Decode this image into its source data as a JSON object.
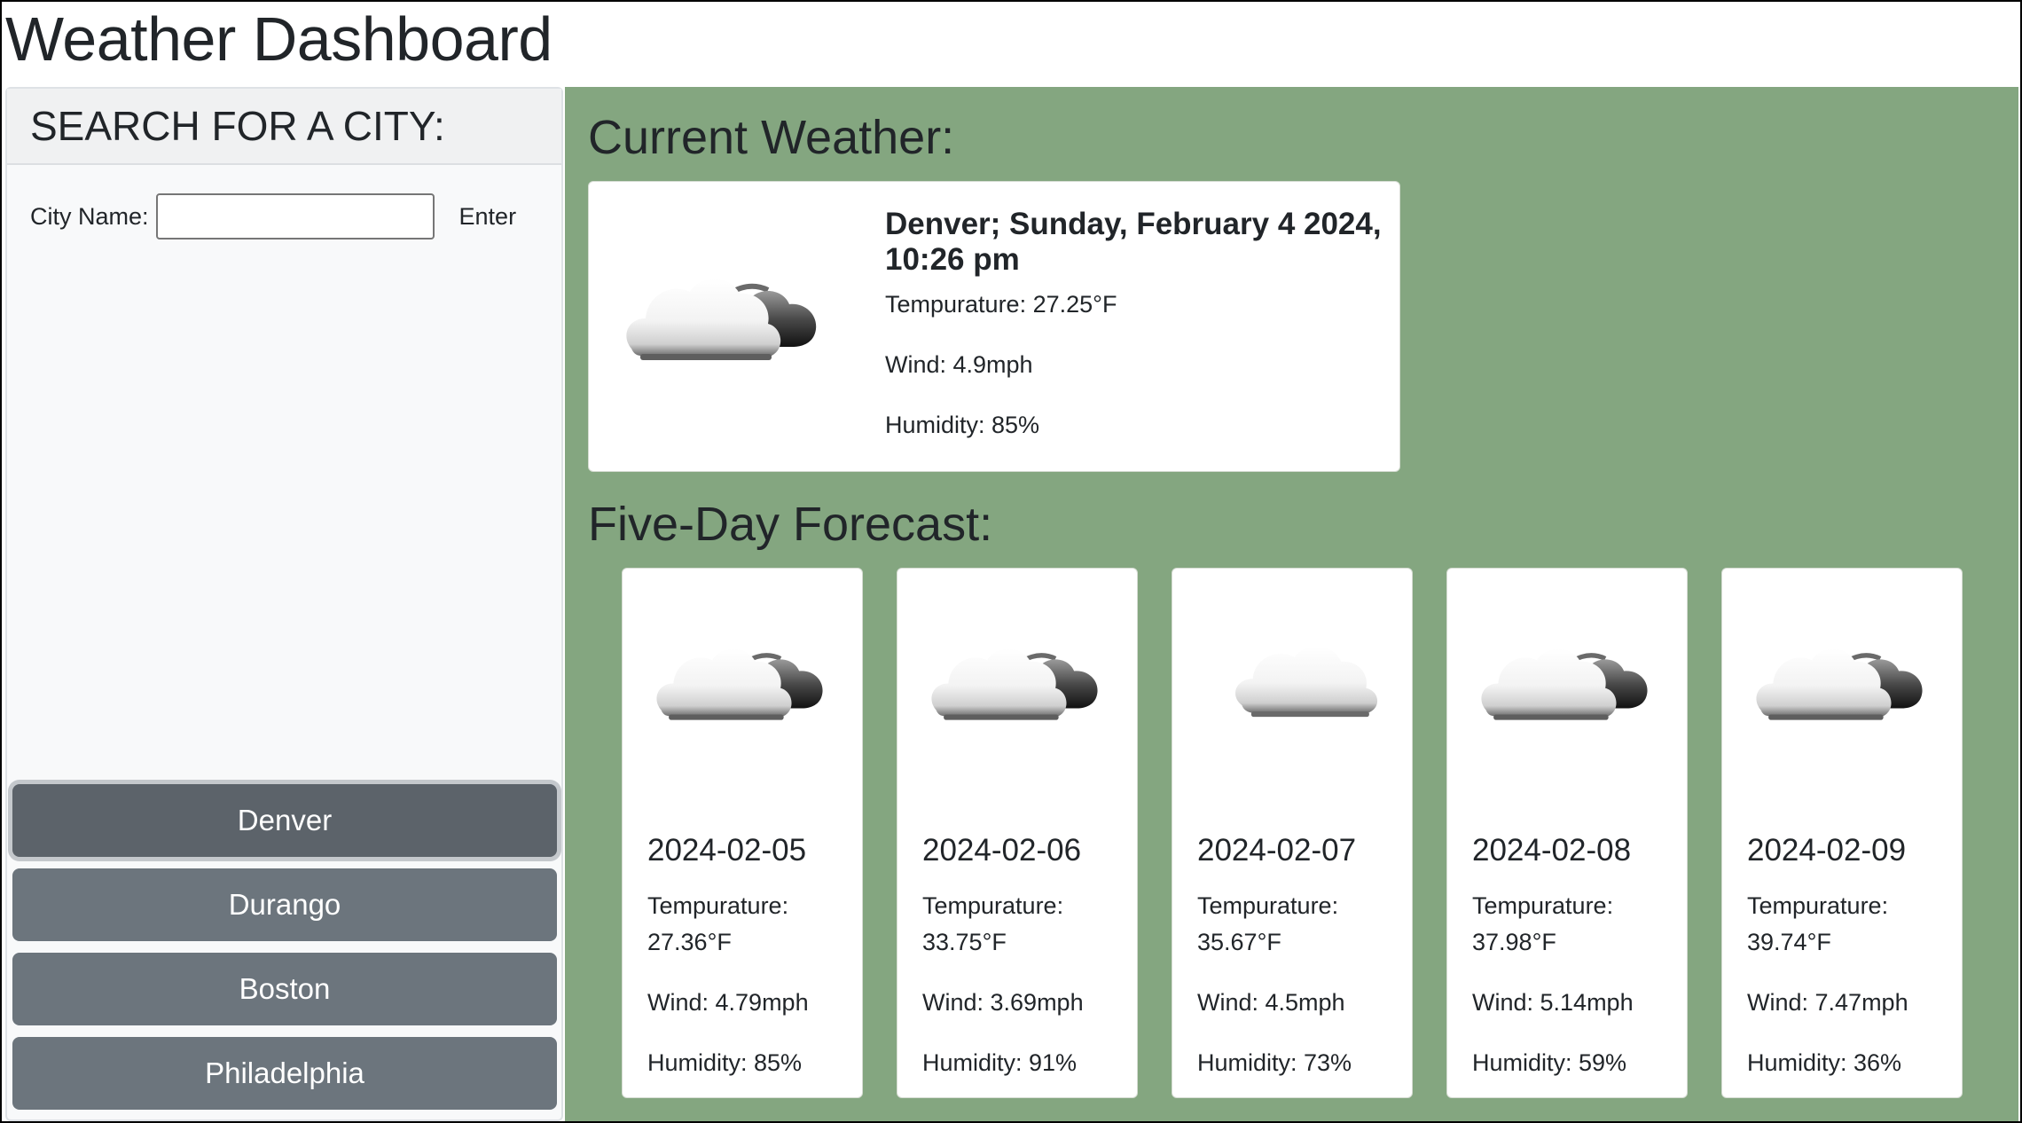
{
  "page": {
    "title": "Weather Dashboard"
  },
  "sidebar": {
    "header": "SEARCH FOR A CITY:",
    "search_label": "City Name:",
    "search_value": "",
    "search_button": "Enter",
    "history": [
      "Denver",
      "Durango",
      "Boston",
      "Philadelphia"
    ],
    "active_city": "Denver"
  },
  "current": {
    "section_title": "Current Weather:",
    "city_datetime": "Denver; Sunday, February 4 2024, 10:26 pm",
    "temperature": "Tempurature: 27.25°F",
    "wind": "Wind: 4.9mph",
    "humidity": "Humidity: 85%",
    "icon": "partly-cloudy-night-icon"
  },
  "forecast": {
    "section_title": "Five-Day Forecast:",
    "days": [
      {
        "date": "2024-02-05",
        "temp": "Tempurature: 27.36°F",
        "wind": "Wind: 4.79mph",
        "humidity": "Humidity: 85%",
        "icon": "broken-clouds-icon"
      },
      {
        "date": "2024-02-06",
        "temp": "Tempurature: 33.75°F",
        "wind": "Wind: 3.69mph",
        "humidity": "Humidity: 91%",
        "icon": "broken-clouds-icon"
      },
      {
        "date": "2024-02-07",
        "temp": "Tempurature: 35.67°F",
        "wind": "Wind: 4.5mph",
        "humidity": "Humidity: 73%",
        "icon": "cloud-icon"
      },
      {
        "date": "2024-02-08",
        "temp": "Tempurature: 37.98°F",
        "wind": "Wind: 5.14mph",
        "humidity": "Humidity: 59%",
        "icon": "broken-clouds-icon"
      },
      {
        "date": "2024-02-09",
        "temp": "Tempurature: 39.74°F",
        "wind": "Wind: 7.47mph",
        "humidity": "Humidity: 36%",
        "icon": "broken-clouds-icon"
      }
    ]
  },
  "colors": {
    "main_bg": "#84a680",
    "sidebar_bg": "#f8f9fa",
    "history_button": "#6c757d",
    "history_button_active": "#5c636a"
  }
}
